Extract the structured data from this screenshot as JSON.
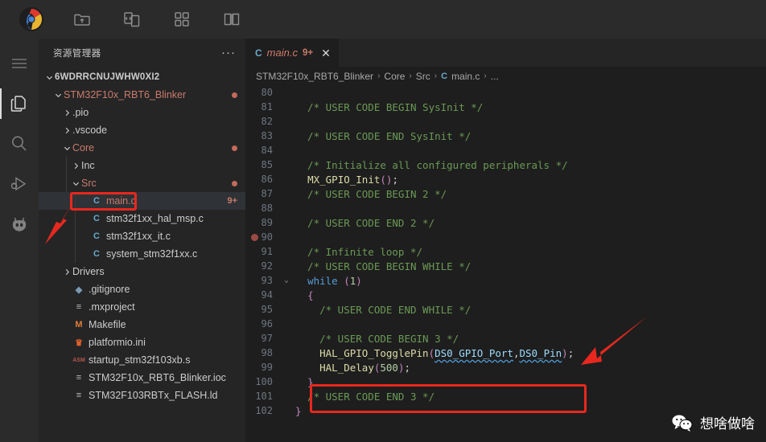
{
  "titlebar": {
    "logo": "pinwheel-logo",
    "icons": [
      {
        "name": "open-folder-icon"
      },
      {
        "name": "compare-files-icon"
      },
      {
        "name": "grid-apps-icon"
      },
      {
        "name": "book-library-icon"
      }
    ]
  },
  "activitybar": {
    "items": [
      {
        "name": "menu-hamburger-icon",
        "active": false
      },
      {
        "name": "explorer-files-icon",
        "active": true
      },
      {
        "name": "search-icon",
        "active": false
      },
      {
        "name": "run-and-debug-icon",
        "active": false
      },
      {
        "name": "platformio-alien-icon",
        "active": false
      }
    ]
  },
  "sidebar": {
    "title": "资源管理器",
    "more_actions": "···",
    "tree": [
      {
        "label": "6WDRRCNUJWHW0XI2",
        "indent": 0,
        "twisty": "down",
        "icon": "",
        "icon_color": "",
        "badge": "",
        "dot": false,
        "root": true,
        "selected": false
      },
      {
        "label": "STM32F10x_RBT6_Blinker",
        "indent": 1,
        "twisty": "down",
        "icon": "",
        "icon_color": "#c97b6a",
        "badge": "",
        "dot": true,
        "folder_modified": true,
        "selected": false
      },
      {
        "label": ".pio",
        "indent": 2,
        "twisty": "right",
        "icon": "",
        "icon_color": "",
        "badge": "",
        "dot": false,
        "selected": false
      },
      {
        "label": ".vscode",
        "indent": 2,
        "twisty": "right",
        "icon": "",
        "icon_color": "",
        "badge": "",
        "dot": false,
        "selected": false
      },
      {
        "label": "Core",
        "indent": 2,
        "twisty": "down",
        "icon": "",
        "icon_color": "#c97b6a",
        "badge": "",
        "dot": true,
        "folder_modified": true,
        "selected": false
      },
      {
        "label": "Inc",
        "indent": 3,
        "twisty": "right",
        "icon": "",
        "icon_color": "",
        "badge": "",
        "dot": false,
        "selected": false
      },
      {
        "label": "Src",
        "indent": 3,
        "twisty": "down",
        "icon": "",
        "icon_color": "#c97b6a",
        "badge": "",
        "dot": true,
        "folder_modified": true,
        "selected": false
      },
      {
        "label": "main.c",
        "indent": 4,
        "twisty": "",
        "icon": "C",
        "icon_color": "#6aa9c9",
        "badge": "9+",
        "dot": false,
        "selected": true,
        "modified": true
      },
      {
        "label": "stm32f1xx_hal_msp.c",
        "indent": 4,
        "twisty": "",
        "icon": "C",
        "icon_color": "#6aa9c9",
        "badge": "",
        "dot": false,
        "selected": false
      },
      {
        "label": "stm32f1xx_it.c",
        "indent": 4,
        "twisty": "",
        "icon": "C",
        "icon_color": "#6aa9c9",
        "badge": "",
        "dot": false,
        "selected": false
      },
      {
        "label": "system_stm32f1xx.c",
        "indent": 4,
        "twisty": "",
        "icon": "C",
        "icon_color": "#6aa9c9",
        "badge": "",
        "dot": false,
        "selected": false
      },
      {
        "label": "Drivers",
        "indent": 2,
        "twisty": "right",
        "icon": "",
        "icon_color": "",
        "badge": "",
        "dot": false,
        "selected": false
      },
      {
        "label": ".gitignore",
        "indent": 2,
        "twisty": "",
        "icon": "◆",
        "icon_color": "#7a9ab5",
        "badge": "",
        "dot": false,
        "selected": false
      },
      {
        "label": ".mxproject",
        "indent": 2,
        "twisty": "",
        "icon": "≡",
        "icon_color": "#b8b8b8",
        "badge": "",
        "dot": false,
        "selected": false
      },
      {
        "label": "Makefile",
        "indent": 2,
        "twisty": "",
        "icon": "M",
        "icon_color": "#e07b39",
        "badge": "",
        "dot": false,
        "selected": false
      },
      {
        "label": "platformio.ini",
        "indent": 2,
        "twisty": "",
        "icon": "♛",
        "icon_color": "#e0622a",
        "badge": "",
        "dot": false,
        "selected": false
      },
      {
        "label": "startup_stm32f103xb.s",
        "indent": 2,
        "twisty": "",
        "icon": "ASM",
        "icon_color": "#b5564a",
        "badge": "",
        "dot": false,
        "selected": false,
        "small_icon": true
      },
      {
        "label": "STM32F10x_RBT6_Blinker.ioc",
        "indent": 2,
        "twisty": "",
        "icon": "≡",
        "icon_color": "#b8b8b8",
        "badge": "",
        "dot": false,
        "selected": false
      },
      {
        "label": "STM32F103RBTx_FLASH.ld",
        "indent": 2,
        "twisty": "",
        "icon": "≡",
        "icon_color": "#b8b8b8",
        "badge": "",
        "dot": false,
        "selected": false
      }
    ]
  },
  "editor": {
    "tab": {
      "icon": "C",
      "filename": "main.c",
      "badge": "9+",
      "close": "✕"
    },
    "breadcrumb": [
      {
        "label": "STM32F10x_RBT6_Blinker",
        "icon": ""
      },
      {
        "label": "Core",
        "icon": ""
      },
      {
        "label": "Src",
        "icon": ""
      },
      {
        "label": "main.c",
        "icon": "C"
      },
      {
        "label": "...",
        "icon": ""
      }
    ],
    "breadcrumb_separator": "›",
    "lines": [
      {
        "n": "80",
        "fold": "",
        "bp": false,
        "tokens": []
      },
      {
        "n": "81",
        "fold": "",
        "bp": false,
        "tokens": [
          {
            "t": "  /* USER CODE BEGIN SysInit */",
            "c": "c-cmt"
          }
        ]
      },
      {
        "n": "82",
        "fold": "",
        "bp": false,
        "tokens": []
      },
      {
        "n": "83",
        "fold": "",
        "bp": false,
        "tokens": [
          {
            "t": "  /* USER CODE END SysInit */",
            "c": "c-cmt"
          }
        ]
      },
      {
        "n": "84",
        "fold": "",
        "bp": false,
        "tokens": []
      },
      {
        "n": "85",
        "fold": "",
        "bp": false,
        "tokens": [
          {
            "t": "  /* Initialize all configured peripherals */",
            "c": "c-cmt"
          }
        ]
      },
      {
        "n": "86",
        "fold": "",
        "bp": false,
        "tokens": [
          {
            "t": "  ",
            "c": "c-pl"
          },
          {
            "t": "MX_GPIO_Init",
            "c": "c-fn"
          },
          {
            "t": "()",
            "c": "c-par"
          },
          {
            "t": ";",
            "c": "c-pl"
          }
        ]
      },
      {
        "n": "87",
        "fold": "",
        "bp": false,
        "tokens": [
          {
            "t": "  /* USER CODE BEGIN 2 */",
            "c": "c-cmt"
          }
        ]
      },
      {
        "n": "88",
        "fold": "",
        "bp": false,
        "tokens": []
      },
      {
        "n": "89",
        "fold": "",
        "bp": false,
        "tokens": [
          {
            "t": "  /* USER CODE END 2 */",
            "c": "c-cmt"
          }
        ]
      },
      {
        "n": "90",
        "fold": "",
        "bp": true,
        "tokens": []
      },
      {
        "n": "91",
        "fold": "",
        "bp": false,
        "tokens": [
          {
            "t": "  /* Infinite loop */",
            "c": "c-cmt"
          }
        ]
      },
      {
        "n": "92",
        "fold": "",
        "bp": false,
        "tokens": [
          {
            "t": "  /* USER CODE BEGIN WHILE */",
            "c": "c-cmt"
          }
        ]
      },
      {
        "n": "93",
        "fold": "⌄",
        "bp": false,
        "tokens": [
          {
            "t": "  ",
            "c": "c-pl"
          },
          {
            "t": "while",
            "c": "c-kw"
          },
          {
            "t": " ",
            "c": "c-pl"
          },
          {
            "t": "(",
            "c": "c-par"
          },
          {
            "t": "1",
            "c": "c-num"
          },
          {
            "t": ")",
            "c": "c-par"
          }
        ]
      },
      {
        "n": "94",
        "fold": "",
        "bp": false,
        "tokens": [
          {
            "t": "  ",
            "c": "c-pl"
          },
          {
            "t": "{",
            "c": "c-brace"
          }
        ]
      },
      {
        "n": "95",
        "fold": "",
        "bp": false,
        "tokens": [
          {
            "t": "    /* USER CODE END WHILE */",
            "c": "c-cmt"
          }
        ]
      },
      {
        "n": "96",
        "fold": "",
        "bp": false,
        "tokens": []
      },
      {
        "n": "97",
        "fold": "",
        "bp": false,
        "tokens": [
          {
            "t": "    /* USER CODE BEGIN 3 */",
            "c": "c-cmt"
          }
        ]
      },
      {
        "n": "98",
        "fold": "",
        "bp": false,
        "tokens": [
          {
            "t": "    ",
            "c": "c-pl"
          },
          {
            "t": "HAL_GPIO_TogglePin",
            "c": "c-fn"
          },
          {
            "t": "(",
            "c": "c-par"
          },
          {
            "t": "DS0_GPIO_Port",
            "c": "c-var squig"
          },
          {
            "t": ",",
            "c": "c-pl"
          },
          {
            "t": "DS0_Pin",
            "c": "c-var squig"
          },
          {
            "t": ")",
            "c": "c-par"
          },
          {
            "t": ";",
            "c": "c-pl"
          }
        ]
      },
      {
        "n": "99",
        "fold": "",
        "bp": false,
        "tokens": [
          {
            "t": "    ",
            "c": "c-pl"
          },
          {
            "t": "HAL_Delay",
            "c": "c-fn"
          },
          {
            "t": "(",
            "c": "c-par"
          },
          {
            "t": "500",
            "c": "c-num"
          },
          {
            "t": ")",
            "c": "c-par"
          },
          {
            "t": ";",
            "c": "c-pl"
          }
        ]
      },
      {
        "n": "100",
        "fold": "",
        "bp": false,
        "tokens": [
          {
            "t": "  ",
            "c": "c-pl"
          },
          {
            "t": "}",
            "c": "c-brace"
          }
        ]
      },
      {
        "n": "101",
        "fold": "",
        "bp": false,
        "tokens": [
          {
            "t": "  /* USER CODE END 3 */",
            "c": "c-cmt"
          }
        ]
      },
      {
        "n": "102",
        "fold": "",
        "bp": false,
        "tokens": [
          {
            "t": "}",
            "c": "c-brace"
          }
        ]
      }
    ]
  },
  "annotations": {
    "highlight_color": "#e8281e",
    "boxes": [
      {
        "name": "highlight-box-mainc-file"
      },
      {
        "name": "highlight-box-code-lines-98-99"
      }
    ],
    "arrows": [
      {
        "name": "annotation-arrow-to-mainc"
      },
      {
        "name": "annotation-arrow-to-code"
      }
    ]
  },
  "watermark": {
    "icon": "wechat-icon",
    "text": "想啥做啥"
  }
}
